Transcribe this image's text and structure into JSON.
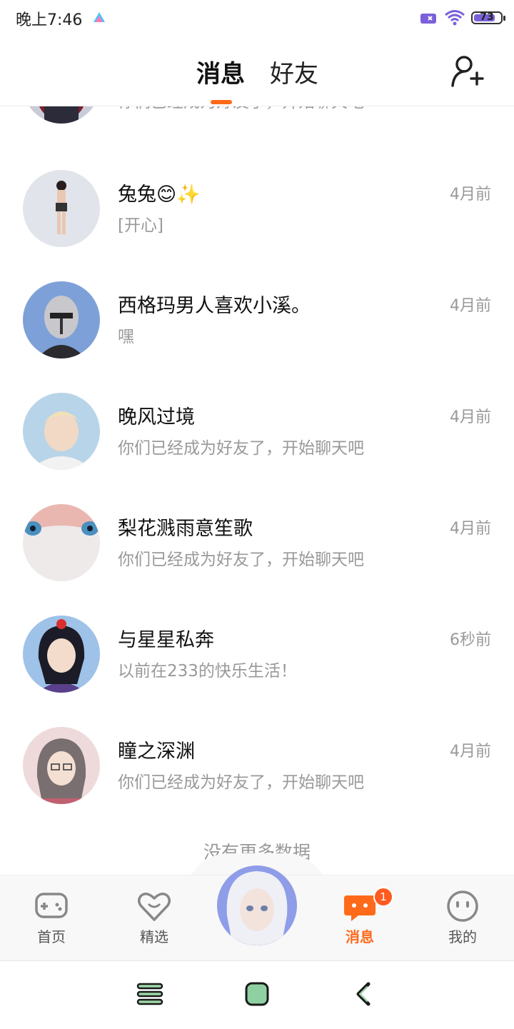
{
  "status_bar": {
    "time": "晚上7:46",
    "battery": "73"
  },
  "header": {
    "tabs": [
      {
        "label": "消息",
        "active": true
      },
      {
        "label": "好友",
        "active": false
      }
    ],
    "add_friend_icon": "add-user-icon",
    "accent": "#ff6a1a"
  },
  "top_partial_row": {
    "preview": "你们已经成为好友了，开始聊天吧"
  },
  "messages": [
    {
      "name": "兔兔",
      "name_emoji": "😊✨",
      "preview": "[开心]",
      "time": "4月前"
    },
    {
      "name": "西格玛男人喜欢小溪。",
      "preview": "嘿",
      "time": "4月前"
    },
    {
      "name": "晚风过境",
      "preview": "你们已经成为好友了，开始聊天吧",
      "time": "4月前"
    },
    {
      "name": "梨花溅雨意笙歌",
      "preview": "你们已经成为好友了，开始聊天吧",
      "time": "4月前"
    },
    {
      "name": "与星星私奔",
      "preview": "以前在233的快乐生活！",
      "time": "6秒前"
    },
    {
      "name": "瞳之深渊",
      "preview": "你们已经成为好友了，开始聊天吧",
      "time": "4月前"
    }
  ],
  "no_more": "没有更多数据",
  "bottom_nav": {
    "items": [
      {
        "label": "首页",
        "icon": "gamepad-icon"
      },
      {
        "label": "精选",
        "icon": "heart-smile-icon"
      },
      {
        "label": "消息",
        "icon": "chat-icon",
        "badge": "1",
        "active": true
      },
      {
        "label": "我的",
        "icon": "face-icon"
      }
    ]
  }
}
